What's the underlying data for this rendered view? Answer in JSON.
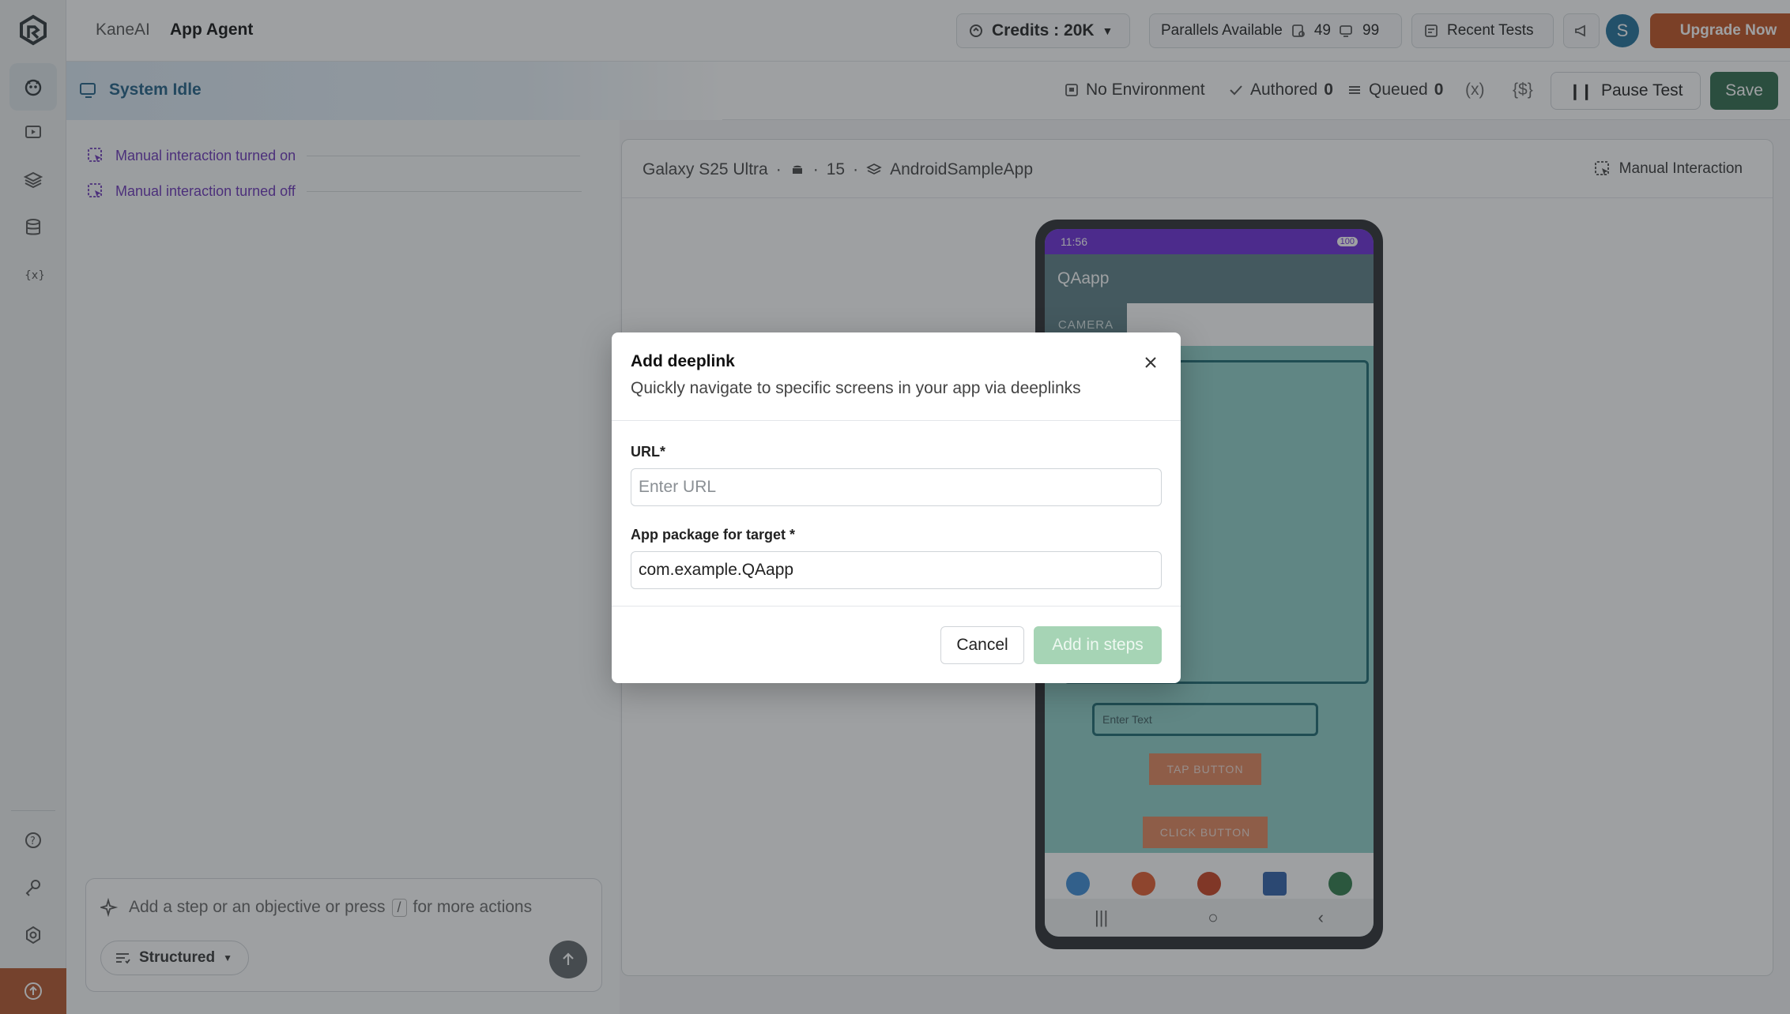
{
  "colors": {
    "accent_green": "#2f6a4c",
    "upgrade_orange": "#c0501f",
    "log_purple": "#6a33b8",
    "idle_blue": "#1f5f86",
    "add_steps_disabled": "#a6d4b5"
  },
  "topbar": {
    "crumb_root": "KaneAI",
    "crumb_current": "App Agent",
    "credits_label": "Credits : 20K",
    "parallels_label": "Parallels Available",
    "parallels_web": "49",
    "parallels_mobile": "99",
    "recent_tests_label": "Recent Tests",
    "avatar_initial": "S",
    "upgrade_label": "Upgrade Now"
  },
  "secbar": {
    "status_label": "System Idle",
    "environment_label": "No Environment",
    "authored_label": "Authored",
    "authored_count": "0",
    "queued_label": "Queued",
    "queued_count": "0",
    "variables_label": "(x)",
    "secrets_label": "{$}",
    "pause_label": "Pause Test",
    "save_label": "Save"
  },
  "log": {
    "items": [
      {
        "label": "Manual interaction turned on"
      },
      {
        "label": "Manual interaction turned off"
      }
    ]
  },
  "composer": {
    "placeholder_before": "Add a step or an objective or press",
    "slash_key": "/",
    "placeholder_after": "for more actions",
    "mode_label": "Structured"
  },
  "device": {
    "model": "Galaxy S25 Ultra",
    "os_version": "15",
    "app_name": "AndroidSampleApp",
    "manual_interaction_label": "Manual Interaction",
    "screen": {
      "time": "11:56",
      "battery": "100",
      "app_title": "QAapp",
      "tab_label": "CAMERA",
      "input_placeholder": "Enter Text",
      "tap_button": "TAP BUTTON",
      "click_button": "CLICK BUTTON"
    }
  },
  "modal": {
    "title": "Add deeplink",
    "subtitle": "Quickly navigate to specific screens in your app via deeplinks",
    "url_label": "URL*",
    "url_placeholder": "Enter URL",
    "url_value": "",
    "package_label": "App package for target *",
    "package_value": "com.example.QAapp",
    "cancel_label": "Cancel",
    "add_label": "Add in steps"
  }
}
